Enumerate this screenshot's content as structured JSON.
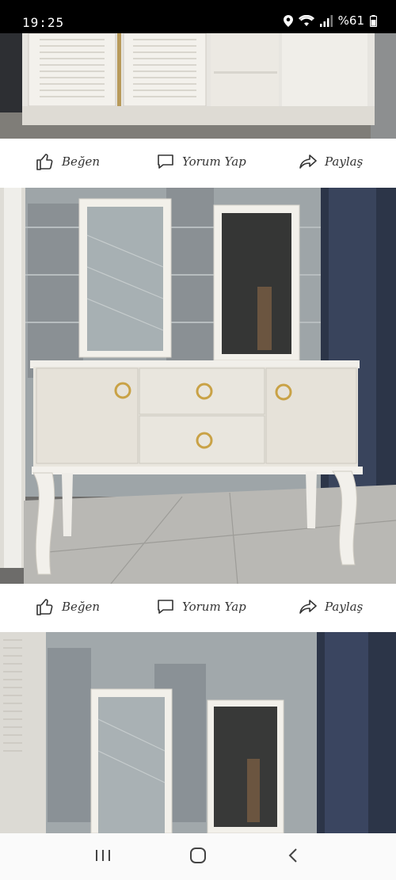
{
  "status": {
    "time": "19:25",
    "battery": "%61",
    "icons": [
      "location-icon",
      "wifi-icon",
      "signal-icon",
      "battery-icon"
    ]
  },
  "posts": [
    {
      "actions": {
        "like": "Beğen",
        "comment": "Yorum Yap",
        "share": "Paylaş"
      }
    },
    {
      "actions": {
        "like": "Beğen",
        "comment": "Yorum Yap",
        "share": "Paylaş"
      }
    }
  ],
  "nav": {
    "icons": [
      "recent-apps-icon",
      "home-icon",
      "back-icon"
    ]
  },
  "colors": {
    "status_bar": "#000000",
    "action_text": "#333333",
    "furniture": "#eeebe4",
    "handle_gold": "#c9a246"
  }
}
